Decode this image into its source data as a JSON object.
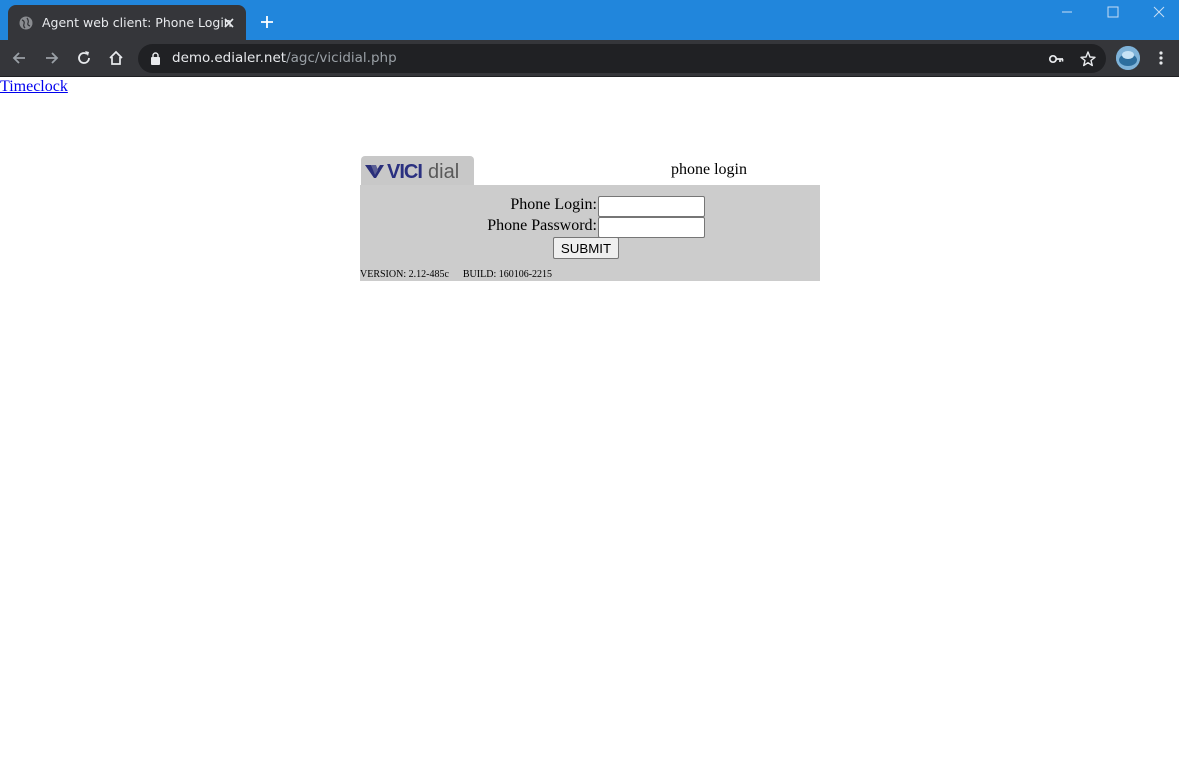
{
  "browser": {
    "tab_title": "Agent web client: Phone Login",
    "url_host": "demo.edialer.net",
    "url_path": "/agc/vicidial.php"
  },
  "page": {
    "timeclock_link": "Timeclock",
    "logo_text_vici": "VICI",
    "logo_text_dial": "dial",
    "heading": "phone login",
    "phone_login_label": "Phone Login:",
    "phone_login_value": "",
    "phone_password_label": "Phone Password:",
    "phone_password_value": "",
    "submit_label": "SUBMIT",
    "version_text": "VERSION: 2.12-485c",
    "build_text": "BUILD: 160106-2215"
  },
  "colors": {
    "tabstrip": "#2186dc",
    "toolbar": "#35363a",
    "panel": "#cccccc",
    "link": "#0000ee"
  },
  "icons": [
    "globe-icon",
    "close-icon",
    "plus-icon",
    "minimize-icon",
    "maximize-icon",
    "back-icon",
    "forward-icon",
    "reload-icon",
    "home-icon",
    "lock-icon",
    "key-icon",
    "star-icon",
    "profile-avatar",
    "menu-icon"
  ]
}
